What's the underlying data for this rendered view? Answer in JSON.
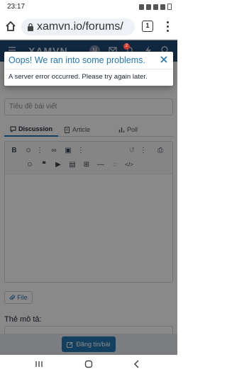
{
  "status_bar": {
    "time": "23:17"
  },
  "browser": {
    "url": "xamvn.io/forums/",
    "tab_count": "1"
  },
  "site_header": {
    "logo": "XAMVN",
    "avatar_letter": "N",
    "notif_count": "2"
  },
  "error_dialog": {
    "title": "Oops! We ran into some problems.",
    "message": "A server error occurred. Please try again later."
  },
  "form": {
    "title_placeholder": "Tiêu đề bài viết",
    "tabs": [
      {
        "label": "Discussion",
        "active": true
      },
      {
        "label": "Article",
        "active": false
      },
      {
        "label": "Poll",
        "active": false
      }
    ],
    "file_button": "File",
    "tags_label": "Thẻ mô tả:",
    "submit_button": "Đăng tin/bài"
  },
  "colors": {
    "accent": "#2577b1",
    "header_bg": "#214a79",
    "error_title": "#2577b1"
  }
}
